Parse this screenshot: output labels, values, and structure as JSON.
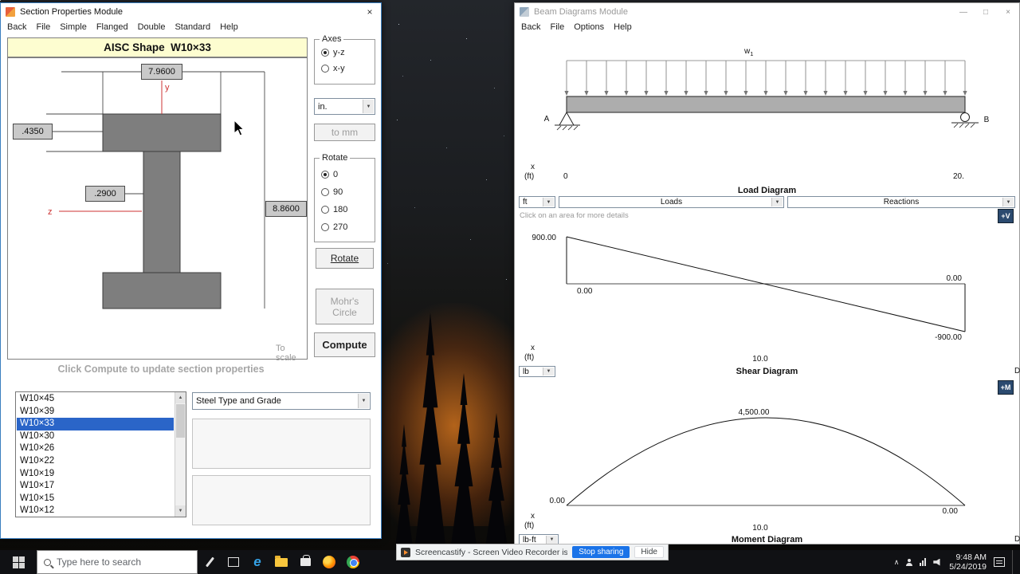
{
  "icons": {
    "close": "×",
    "minimize": "—",
    "maximize": "□",
    "dropdown": "▼",
    "scroll_up": "▲",
    "scroll_down": "▼",
    "tray_chevron": "∧",
    "edge_letter": "e"
  },
  "colors": {
    "selection_blue": "#2a65c8",
    "stop_button_blue": "#1a73e8",
    "header_yellow": "#fdfdd0",
    "axis_red": "#cc3333"
  },
  "section_window": {
    "title": "Section Properties Module",
    "menu": [
      "Back",
      "File",
      "Simple",
      "Flanged",
      "Double",
      "Standard",
      "Help"
    ],
    "header": "AISC Shape  W10×33",
    "diagram": {
      "dim_flange_width": "7.9600",
      "dim_flange_thickness": ".4350",
      "dim_web_thickness": ".2900",
      "dim_depth": "8.8600",
      "axis_y": "y",
      "axis_z": "z",
      "to_scale_note": "To scale"
    },
    "axes_group": {
      "label": "Axes",
      "options": [
        "y-z",
        "x-y"
      ],
      "selected": "y-z"
    },
    "units_value": "in.",
    "to_mm_button": "to mm",
    "rotate_group": {
      "label": "Rotate",
      "options": [
        "0",
        "90",
        "180",
        "270"
      ],
      "selected": "0"
    },
    "rotate_button": "Rotate",
    "mohrs_button": [
      "Mohr's",
      "Circle"
    ],
    "compute_button": "Compute",
    "hint": "Click Compute to update section properties",
    "shapes": [
      "W10×45",
      "W10×39",
      "W10×33",
      "W10×30",
      "W10×26",
      "W10×22",
      "W10×19",
      "W10×17",
      "W10×15",
      "W10×12"
    ],
    "selected_shape": "W10×33",
    "steel_dropdown_value": "Steel Type and Grade"
  },
  "beam_window": {
    "title": "Beam Diagrams Module",
    "menu": [
      "Back",
      "File",
      "Options",
      "Help"
    ],
    "load": {
      "w": "w",
      "w_sub": "1",
      "support_a": "A",
      "support_b": "B",
      "x": "x",
      "x_unit": "(ft)",
      "x_start": "0",
      "x_end": "20.",
      "caption": "Load Diagram"
    },
    "controls": {
      "length_unit": "ft",
      "loads": "Loads",
      "reactions": "Reactions",
      "hint": "Click on an area for more details"
    },
    "shear": {
      "toggle": "+V",
      "unit": "lb",
      "caption": "Shear Diagram",
      "edge": "D",
      "v_max": "900.00",
      "zero_left": "0.00",
      "zero_right": "0.00",
      "v_min": "-900.00",
      "x": "x",
      "x_unit": "(ft)",
      "x_mid": "10.0"
    },
    "moment": {
      "toggle": "+M",
      "unit": "lb-ft",
      "caption": "Moment Diagram",
      "edge": "D",
      "m_max": "4,500.00",
      "zero_left": "0.00",
      "zero_right": "0.00",
      "x": "x",
      "x_unit": "(ft)",
      "x_mid": "10.0"
    }
  },
  "chart_data": [
    {
      "type": "line",
      "title": "Shear Diagram",
      "xlabel": "x (ft)",
      "ylabel": "lb",
      "x": [
        0,
        10,
        20
      ],
      "values": [
        900,
        0,
        -900
      ],
      "xlim": [
        0,
        20
      ]
    },
    {
      "type": "line",
      "title": "Moment Diagram",
      "xlabel": "x (ft)",
      "ylabel": "lb-ft",
      "x": [
        0,
        10,
        20
      ],
      "values": [
        0,
        4500,
        0
      ],
      "xlim": [
        0,
        20
      ]
    }
  ],
  "taskbar": {
    "search_placeholder": "Type here to search",
    "notification": {
      "text": "Screencastify - Screen Video Recorder is sharing your screen.",
      "stop_button": "Stop sharing",
      "hide_button": "Hide"
    },
    "clock": {
      "time": "9:48 AM",
      "date": "5/24/2019"
    }
  }
}
